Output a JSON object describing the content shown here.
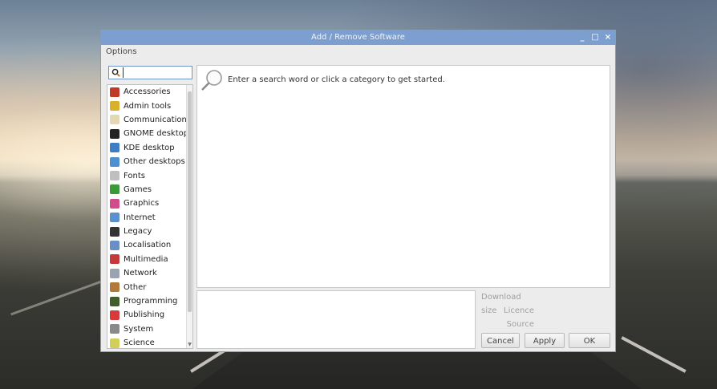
{
  "window": {
    "title": "Add / Remove Software",
    "controls": {
      "minimize": "_",
      "maximize": "□",
      "close": "×"
    }
  },
  "menu": {
    "options": "Options"
  },
  "search": {
    "value": "",
    "placeholder": ""
  },
  "categories": [
    {
      "label": "Accessories",
      "icon": "accessories-icon",
      "color": "#c0392b"
    },
    {
      "label": "Admin tools",
      "icon": "admin-tools-icon",
      "color": "#d8b02a"
    },
    {
      "label": "Communication",
      "icon": "communication-icon",
      "color": "#e3d8b6"
    },
    {
      "label": "GNOME desktop",
      "icon": "gnome-icon",
      "color": "#222222"
    },
    {
      "label": "KDE desktop",
      "icon": "kde-icon",
      "color": "#3f7ec5"
    },
    {
      "label": "Other desktops",
      "icon": "other-desktops-icon",
      "color": "#4e8fd0"
    },
    {
      "label": "Fonts",
      "icon": "fonts-icon",
      "color": "#bfbfbf"
    },
    {
      "label": "Games",
      "icon": "games-icon",
      "color": "#3a9a3a"
    },
    {
      "label": "Graphics",
      "icon": "graphics-icon",
      "color": "#d04c8a"
    },
    {
      "label": "Internet",
      "icon": "internet-icon",
      "color": "#5a8fd0"
    },
    {
      "label": "Legacy",
      "icon": "legacy-icon",
      "color": "#333333"
    },
    {
      "label": "Localisation",
      "icon": "localisation-icon",
      "color": "#6a8fc5"
    },
    {
      "label": "Multimedia",
      "icon": "multimedia-icon",
      "color": "#c43a3a"
    },
    {
      "label": "Network",
      "icon": "network-icon",
      "color": "#9aa4b0"
    },
    {
      "label": "Other",
      "icon": "other-icon",
      "color": "#b07a3a"
    },
    {
      "label": "Programming",
      "icon": "programming-icon",
      "color": "#3f5e2a"
    },
    {
      "label": "Publishing",
      "icon": "publishing-icon",
      "color": "#d63a3a"
    },
    {
      "label": "System",
      "icon": "system-icon",
      "color": "#8a8a8a"
    },
    {
      "label": "Science",
      "icon": "science-icon",
      "color": "#cfcf5a"
    }
  ],
  "results": {
    "hint": "Enter a search word or click a category to get started."
  },
  "details": {
    "download_size": "Download size",
    "licence": "Licence",
    "source": "Source"
  },
  "buttons": {
    "cancel": "Cancel",
    "apply": "Apply",
    "ok": "OK"
  },
  "colors": {
    "titlebar": "#7c9fd0",
    "accent": "#6f94c8"
  }
}
